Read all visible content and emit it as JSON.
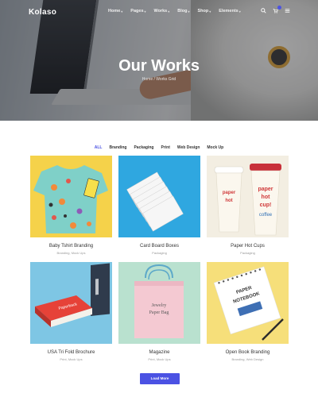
{
  "header": {
    "logo": "Kolaso",
    "nav": [
      {
        "label": "Home",
        "dropdown": true
      },
      {
        "label": "Pages",
        "dropdown": true
      },
      {
        "label": "Works",
        "dropdown": true
      },
      {
        "label": "Blog",
        "dropdown": true
      },
      {
        "label": "Shop",
        "dropdown": true
      },
      {
        "label": "Elements",
        "dropdown": true
      }
    ],
    "icons": [
      "search-icon",
      "cart-icon",
      "menu-icon"
    ]
  },
  "hero": {
    "title": "Our Works",
    "breadcrumb_home": "Home",
    "breadcrumb_sep": "/",
    "breadcrumb_current": "Works Grid"
  },
  "filters": [
    "ALL",
    "Branding",
    "Packaging",
    "Print",
    "Web Design",
    "Mock Up"
  ],
  "active_filter": "ALL",
  "works": [
    {
      "title": "Baby Tshirt Branding",
      "subtitle": "Branding, Mock Ups"
    },
    {
      "title": "Card Board Boxes",
      "subtitle": "Packaging"
    },
    {
      "title": "Paper Hot Cups",
      "subtitle": "Packaging"
    },
    {
      "title": "USA Tri Fold Brochure",
      "subtitle": "Print, Mock Ups"
    },
    {
      "title": "Magazine",
      "subtitle": "Print, Mock Ups"
    },
    {
      "title": "Open Book Branding",
      "subtitle": "Branding, Web Design"
    }
  ],
  "load_more": "Load More",
  "colors": {
    "accent": "#4b52e3",
    "card1_bg": "#f5d24a",
    "card2_bg": "#2fa7e0",
    "card3_bg": "#f3eee2",
    "card4_bg": "#7ec6e4",
    "card5_bg": "#b9e1cf",
    "card6_bg": "#f6df7a"
  }
}
